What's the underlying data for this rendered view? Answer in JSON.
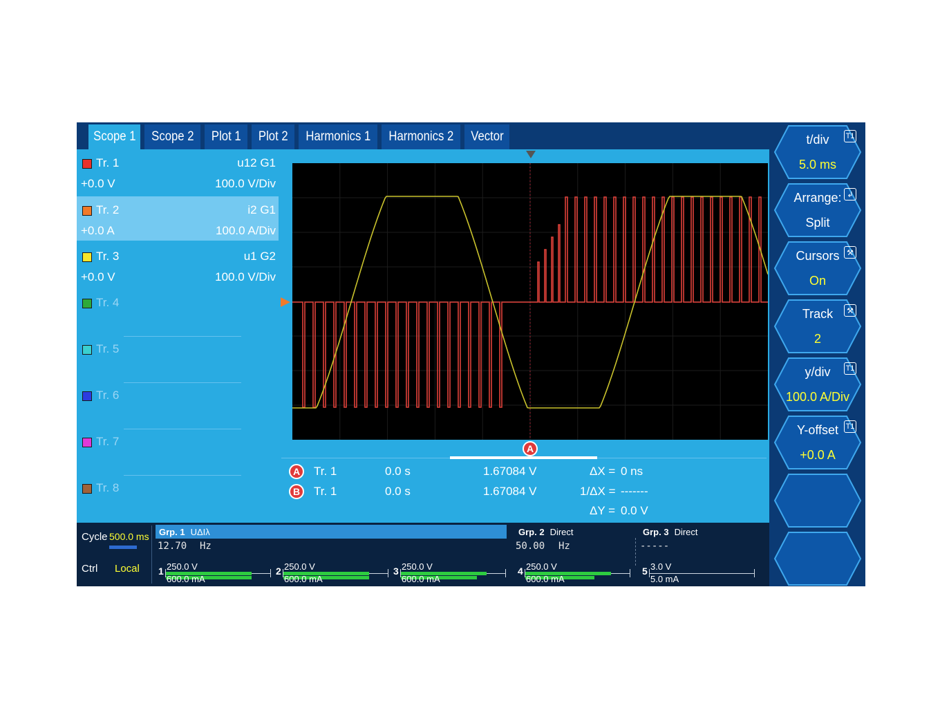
{
  "tabs": [
    {
      "label": "Scope 1",
      "active": true
    },
    {
      "label": "Scope 2",
      "active": false
    },
    {
      "label": "Plot 1",
      "active": false
    },
    {
      "label": "Plot 2",
      "active": false
    },
    {
      "label": "Harmonics 1",
      "active": false
    },
    {
      "label": "Harmonics 2",
      "active": false
    },
    {
      "label": "Vector",
      "active": false
    }
  ],
  "traces": [
    {
      "name": "Tr. 1",
      "color": "#e8322c",
      "source": "u12 G1",
      "offset": "+0.0 V",
      "scale": "100.0 V/Div"
    },
    {
      "name": "Tr. 2",
      "color": "#f07a2a",
      "source": "i2 G1",
      "offset": "+0.0 A",
      "scale": "100.0 A/Div"
    },
    {
      "name": "Tr. 3",
      "color": "#f5e62a",
      "source": "u1 G2",
      "offset": "+0.0 V",
      "scale": "100.0 V/Div"
    },
    {
      "name": "Tr. 4",
      "color": "#2eaa3a"
    },
    {
      "name": "Tr. 5",
      "color": "#3ad0d0"
    },
    {
      "name": "Tr. 6",
      "color": "#2c3ce0"
    },
    {
      "name": "Tr. 7",
      "color": "#e03ad8"
    },
    {
      "name": "Tr. 8",
      "color": "#a0623a"
    }
  ],
  "scope": {
    "colors": {
      "current": "#e0413a",
      "voltage": "#c9c22c",
      "grid": "#2a2a2a"
    }
  },
  "cursors": {
    "a_label": "A",
    "b_label": "B",
    "a": {
      "trace": "Tr. 1",
      "time": "0.0 s",
      "value": "1.67084 V"
    },
    "b": {
      "trace": "Tr. 1",
      "time": "0.0 s",
      "value": "1.67084 V"
    },
    "dx_label": "ΔX =",
    "dx_value": "0 ns",
    "inv_dx_label": "1/ΔX =",
    "inv_dx_value": "-------",
    "dy_label": "ΔY =",
    "dy_value": "0.0 V"
  },
  "status": {
    "cycle_label": "Cycle",
    "cycle_value": "500.0 ms",
    "ctrl_label": "Ctrl",
    "ctrl_value": "Local",
    "groups": [
      {
        "name": "Grp. 1",
        "mode": "UΔIλ",
        "freq": "12.70",
        "freq_unit": "Hz"
      },
      {
        "name": "Grp. 2",
        "mode": "Direct",
        "freq": "50.00",
        "freq_unit": "Hz"
      },
      {
        "name": "Grp. 3",
        "mode": "Direct",
        "freq": "-----",
        "freq_unit": ""
      }
    ],
    "channels": [
      {
        "num": "1",
        "voltage": "250.0 V",
        "current": "600.0 mA"
      },
      {
        "num": "2",
        "voltage": "250.0 V",
        "current": "600.0 mA"
      },
      {
        "num": "3",
        "voltage": "250.0 V",
        "current": "600.0 mA"
      },
      {
        "num": "4",
        "voltage": "250.0 V",
        "current": "600.0 mA"
      },
      {
        "num": "5",
        "voltage": "3.0 V",
        "current": "5.0 mA"
      }
    ]
  },
  "softkeys": [
    {
      "label": "t/div",
      "value": "5.0 ms",
      "icon": "T1"
    },
    {
      "label": "Arrange:",
      "value": "Split",
      "icon": "↲"
    },
    {
      "label": "Cursors",
      "value": "On",
      "icon": "⚒"
    },
    {
      "label": "Track",
      "value": "2",
      "icon": "⚒"
    },
    {
      "label": "y/div",
      "value": "100.0 A/Div",
      "icon": "T1"
    },
    {
      "label": "Y-offset",
      "value": "+0.0 A",
      "icon": "T1"
    },
    {
      "label": "",
      "value": "",
      "icon": ""
    },
    {
      "label": "",
      "value": "",
      "icon": ""
    }
  ]
}
